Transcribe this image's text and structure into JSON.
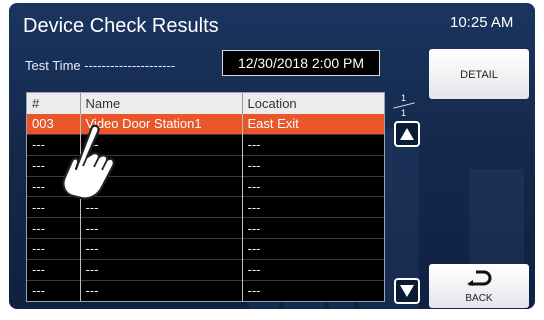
{
  "header": {
    "title": "Device Check Results",
    "time": "10:25 AM"
  },
  "test_time": {
    "label": "Test Time ---------------------",
    "value": "12/30/2018  2:00 PM"
  },
  "buttons": {
    "detail": "DETAIL",
    "back": "BACK"
  },
  "table": {
    "columns": [
      "#",
      "Name",
      "Location"
    ],
    "rows": [
      [
        "003",
        "Video Door Station1",
        "East Exit"
      ],
      [
        "---",
        "---",
        "---"
      ],
      [
        "---",
        "---",
        "---"
      ],
      [
        "---",
        "---",
        "---"
      ],
      [
        "---",
        "---",
        "---"
      ],
      [
        "---",
        "---",
        "---"
      ],
      [
        "---",
        "---",
        "---"
      ],
      [
        "---",
        "---",
        "---"
      ],
      [
        "---",
        "---",
        "---"
      ]
    ],
    "selected_row": 0
  },
  "pagination": {
    "current": "1",
    "total": "1"
  },
  "icons": {
    "scroll_up": "triangle-up-icon",
    "scroll_down": "triangle-down-icon",
    "back": "return-arrow-icon",
    "touch": "pointing-hand-icon"
  },
  "colors": {
    "selected_row": "#e8562a",
    "background": "#14294c"
  }
}
